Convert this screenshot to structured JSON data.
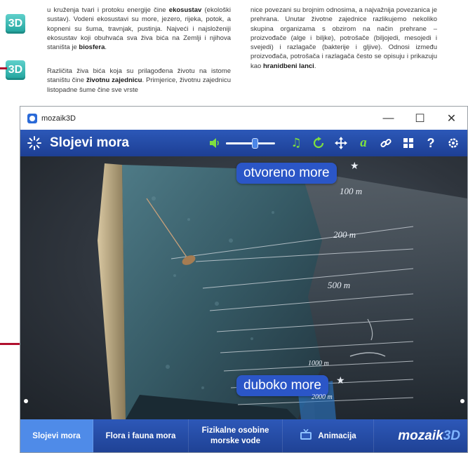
{
  "textbook": {
    "left_para_1": [
      "u kruženja tvari i protoku energije čine ",
      "ekosustav",
      " (ekološki sustav). Vodeni ekosustavi su more, jezero, rijeka, potok, a kopneni su šuma, travnjak, pustinja. Najveći i najsloženiji ekosustav koji obuhvaća sva živa bića na Zemlji i njihova staništa je ",
      "biosfera",
      "."
    ],
    "left_para_2": [
      "Različita živa bića koja su prilagođena životu na istome staništu čine ",
      "životnu zajednicu",
      ". Primjerice, životnu zajednicu listopadne šume čine sve vrste"
    ],
    "right_para": [
      "nice povezani su brojnim odnosima, a najvažnija povezanica je prehrana. Unutar životne zajednice razlikujemo nekoliko skupina organizama s obzirom na način prehrane – proizvođače (alge i biljke), potrošače (biljojedi, mesojedi i svejedi) i razlagače (bakterije i gljive). Odnosi između proizvođača, potrošača i razlagača često se opisuju i prikazuju kao ",
      "hranidbeni lanci",
      "."
    ],
    "badge_label": "3D"
  },
  "window": {
    "title": "mozaik3D",
    "minimize": "—",
    "maximize": "☐",
    "close": "✕"
  },
  "toolbar": {
    "title": "Slojevi mora",
    "volume_level": 0.6,
    "help": "?"
  },
  "scene": {
    "top_label": "otvoreno more",
    "bottom_label": "duboko more",
    "depths": [
      "100 m",
      "200 m",
      "500 m",
      "1000 m",
      "2000 m"
    ]
  },
  "bottom_nav": {
    "items": [
      {
        "label": "Slojevi mora",
        "active": true
      },
      {
        "label": "Flora i fauna mora",
        "active": false
      },
      {
        "label": "Fizikalne osobine\nmorske vode",
        "active": false
      },
      {
        "label": "Animacija",
        "active": false
      }
    ],
    "brand_main": "mozaik",
    "brand_accent": "3D"
  },
  "colors": {
    "accent": "#2b56c7",
    "toolbar_green": "#7ee03f",
    "pointer": "#b0102e"
  },
  "icons": [
    "badge-3d-icon",
    "app-logo-icon",
    "settings-sun-icon",
    "volume-icon",
    "music-note-icon",
    "reset-icon",
    "move-icon",
    "text-label-icon",
    "link-icon",
    "grid-icon",
    "help-icon",
    "gear-icon",
    "star-icon",
    "animation-tv-icon"
  ]
}
